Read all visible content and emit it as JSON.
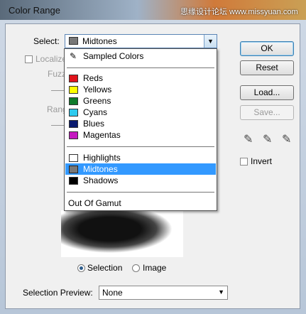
{
  "window": {
    "title": "Color Range",
    "watermark": "思缘设计论坛 www.missyuan.com"
  },
  "select": {
    "label": "Select:",
    "value": "Midtones",
    "swatch": "#777777"
  },
  "localize": {
    "label": "Localize"
  },
  "fuzziness": {
    "label": "Fuzzi"
  },
  "range": {
    "label": "Rang"
  },
  "dropdown": {
    "items": [
      {
        "label": "Sampled Colors",
        "swatch": "",
        "icon": "eyedropper-icon",
        "selected": false
      },
      {
        "label": "Reds",
        "swatch": "#e0141b",
        "selected": false
      },
      {
        "label": "Yellows",
        "swatch": "#ffff00",
        "selected": false
      },
      {
        "label": "Greens",
        "swatch": "#0f7a2a",
        "selected": false
      },
      {
        "label": "Cyans",
        "swatch": "#2ecbef",
        "selected": false
      },
      {
        "label": "Blues",
        "swatch": "#0a1a6e",
        "selected": false
      },
      {
        "label": "Magentas",
        "swatch": "#c519c0",
        "selected": false
      },
      {
        "label": "Highlights",
        "swatch": "#ffffff",
        "selected": false
      },
      {
        "label": "Midtones",
        "swatch": "#777777",
        "selected": true
      },
      {
        "label": "Shadows",
        "swatch": "#000000",
        "selected": false
      },
      {
        "label": "Out Of Gamut",
        "swatch": "",
        "selected": false
      }
    ]
  },
  "buttons": {
    "ok": "OK",
    "reset": "Reset",
    "load": "Load...",
    "save": "Save..."
  },
  "invert": {
    "label": "Invert"
  },
  "view": {
    "selection": "Selection",
    "image": "Image"
  },
  "selection_preview": {
    "label": "Selection Preview:",
    "value": "None"
  },
  "colors": {
    "accent": "#3399ff"
  }
}
